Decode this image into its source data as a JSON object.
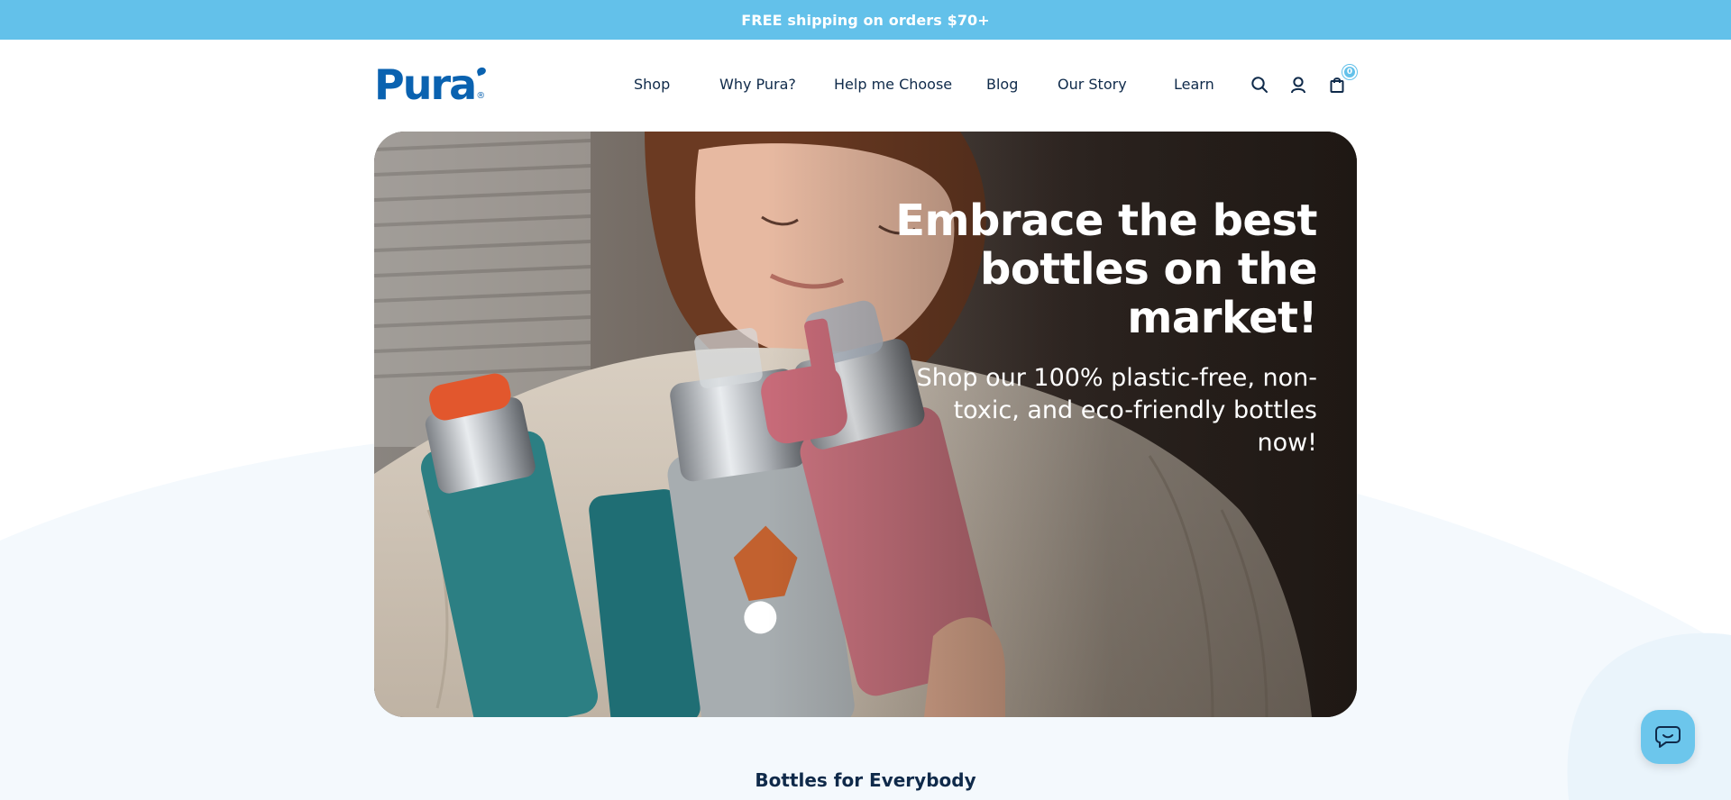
{
  "announcement": {
    "text": "FREE shipping on orders $70+"
  },
  "brand": {
    "logo_text": "Pura",
    "logo_registered": "®",
    "primary_color": "#0a62b0",
    "accent_color": "#63c1ea"
  },
  "nav": {
    "items": [
      {
        "label": "Shop"
      },
      {
        "label": "Why Pura?"
      },
      {
        "label": "Help me Choose"
      },
      {
        "label": "Blog"
      },
      {
        "label": "Our Story"
      },
      {
        "label": "Learn"
      }
    ]
  },
  "header_icons": {
    "search": "search-icon",
    "account": "account-icon",
    "cart": "cart-icon",
    "cart_count": "0"
  },
  "hero": {
    "heading": "Embrace the best bottles on the market!",
    "subheading": "Shop our 100% plastic-free, non-toxic, and eco-friendly bottles now!"
  },
  "section": {
    "title": "Bottles for Everybody"
  },
  "chat": {
    "icon": "chat-icon"
  }
}
